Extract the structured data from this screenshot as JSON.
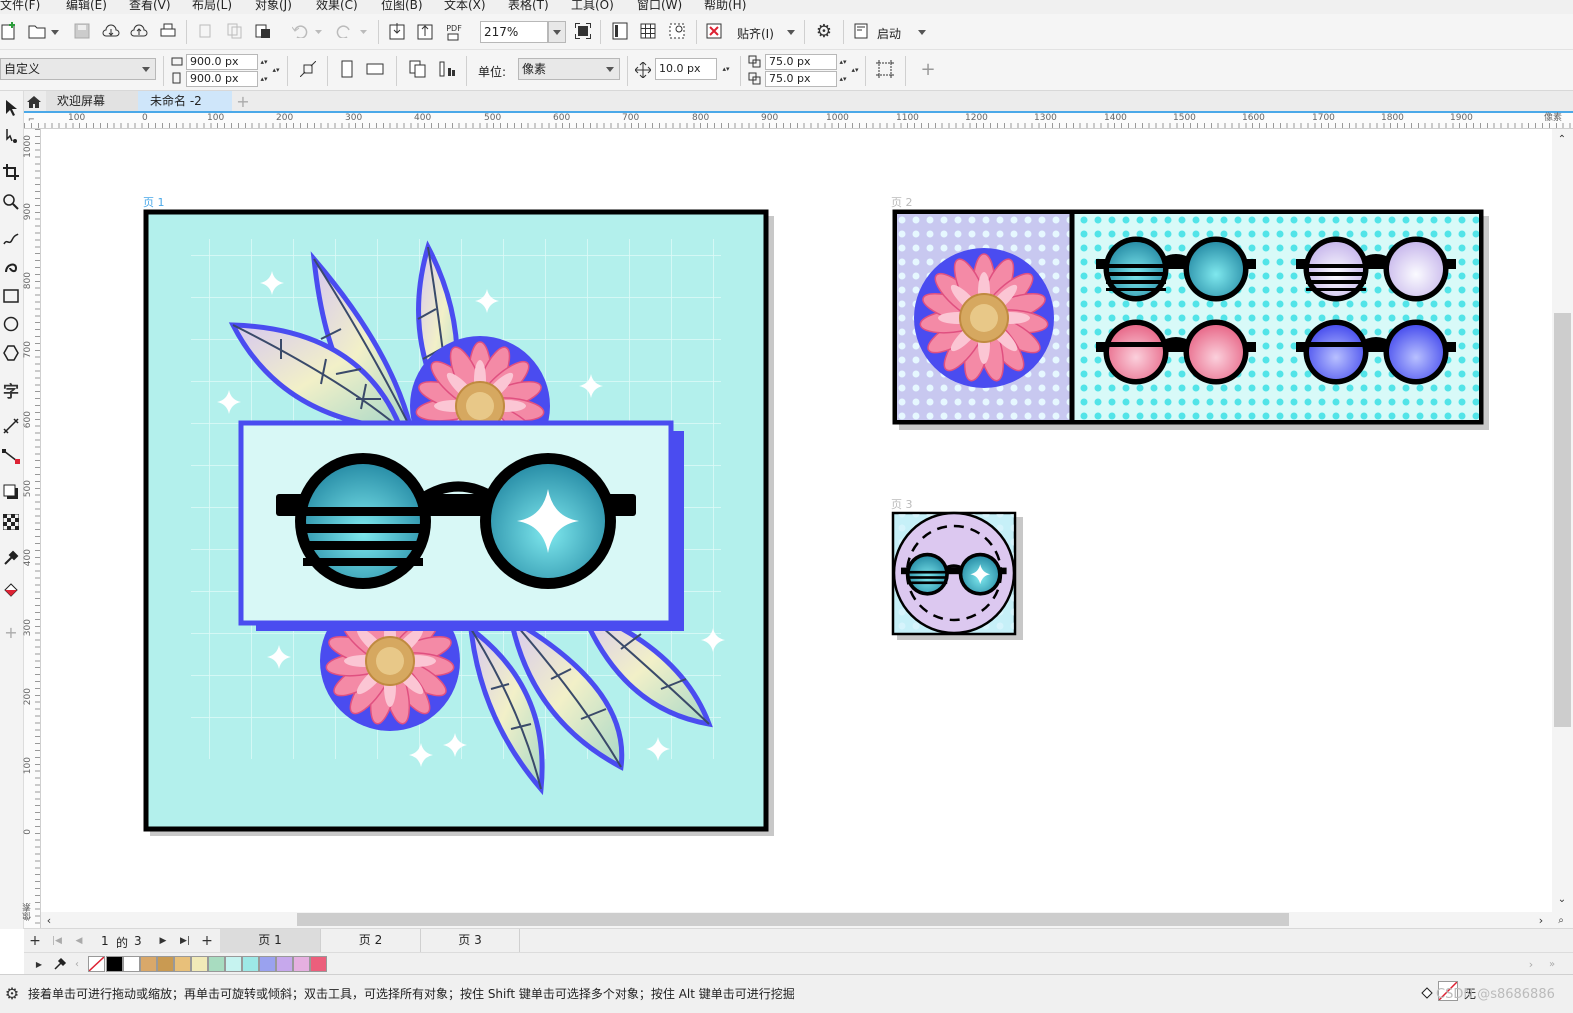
{
  "menu": [
    "文件(F)",
    "编辑(E)",
    "查看(V)",
    "布局(L)",
    "对象(J)",
    "效果(C)",
    "位图(B)",
    "文本(X)",
    "表格(T)",
    "工具(O)",
    "窗口(W)",
    "帮助(H)"
  ],
  "toolbar1": {
    "pdf_label": "PDF",
    "zoom_value": "217%",
    "snap_label": "贴齐(I)",
    "launch_label": "启动"
  },
  "toolbar2": {
    "preset": "自定义",
    "width": "900.0 px",
    "height": "900.0 px",
    "unit_label": "单位:",
    "unit_value": "像素",
    "nudge": "10.0 px",
    "dup_x": "75.0 px",
    "dup_y": "75.0 px"
  },
  "tabs": {
    "welcome": "欢迎屏幕",
    "document": "未命名 -2"
  },
  "rulers": {
    "h_labels": [
      "100",
      "0",
      "100",
      "200",
      "300",
      "400",
      "500",
      "600",
      "700",
      "800",
      "900",
      "1000",
      "1100",
      "1200",
      "1300",
      "1400",
      "1500",
      "1600",
      "1700",
      "1800",
      "1900",
      "像素"
    ],
    "v_labels": [
      "1000",
      "900",
      "800",
      "700",
      "600",
      "500",
      "400",
      "300",
      "200",
      "100",
      "0",
      "像素"
    ]
  },
  "pages": {
    "page1_label": "页 1",
    "page2_label": "页 2",
    "page3_label": "页 3"
  },
  "pagebar": {
    "counter_current": "1",
    "counter_of": "的",
    "counter_total": "3",
    "tabs": [
      "页 1",
      "页 2",
      "页 3"
    ]
  },
  "palette": {
    "swatches": [
      "#000000",
      "#ffffff",
      "#d9a86a",
      "#c99a52",
      "#e8c07a",
      "#f1eab8",
      "#a8dcc0",
      "#c6f3f0",
      "#9de8e6",
      "#9aa2ef",
      "#c6a8ec",
      "#e6b0e0",
      "#ec5f7c"
    ]
  },
  "status": {
    "message": "接着单击可进行拖动或缩放；再单击可旋转或倾斜；双击工具，可选择所有对象；按住 Shift 键单击可选择多个对象；按住 Alt 键单击可进行挖掘",
    "fill_label": "无",
    "watermark": "CSDN @s8686886"
  },
  "colors": {
    "accent": "#4aa8e8",
    "page_bg": "#b3f0ec",
    "blue_outline": "#4a4cf0"
  }
}
